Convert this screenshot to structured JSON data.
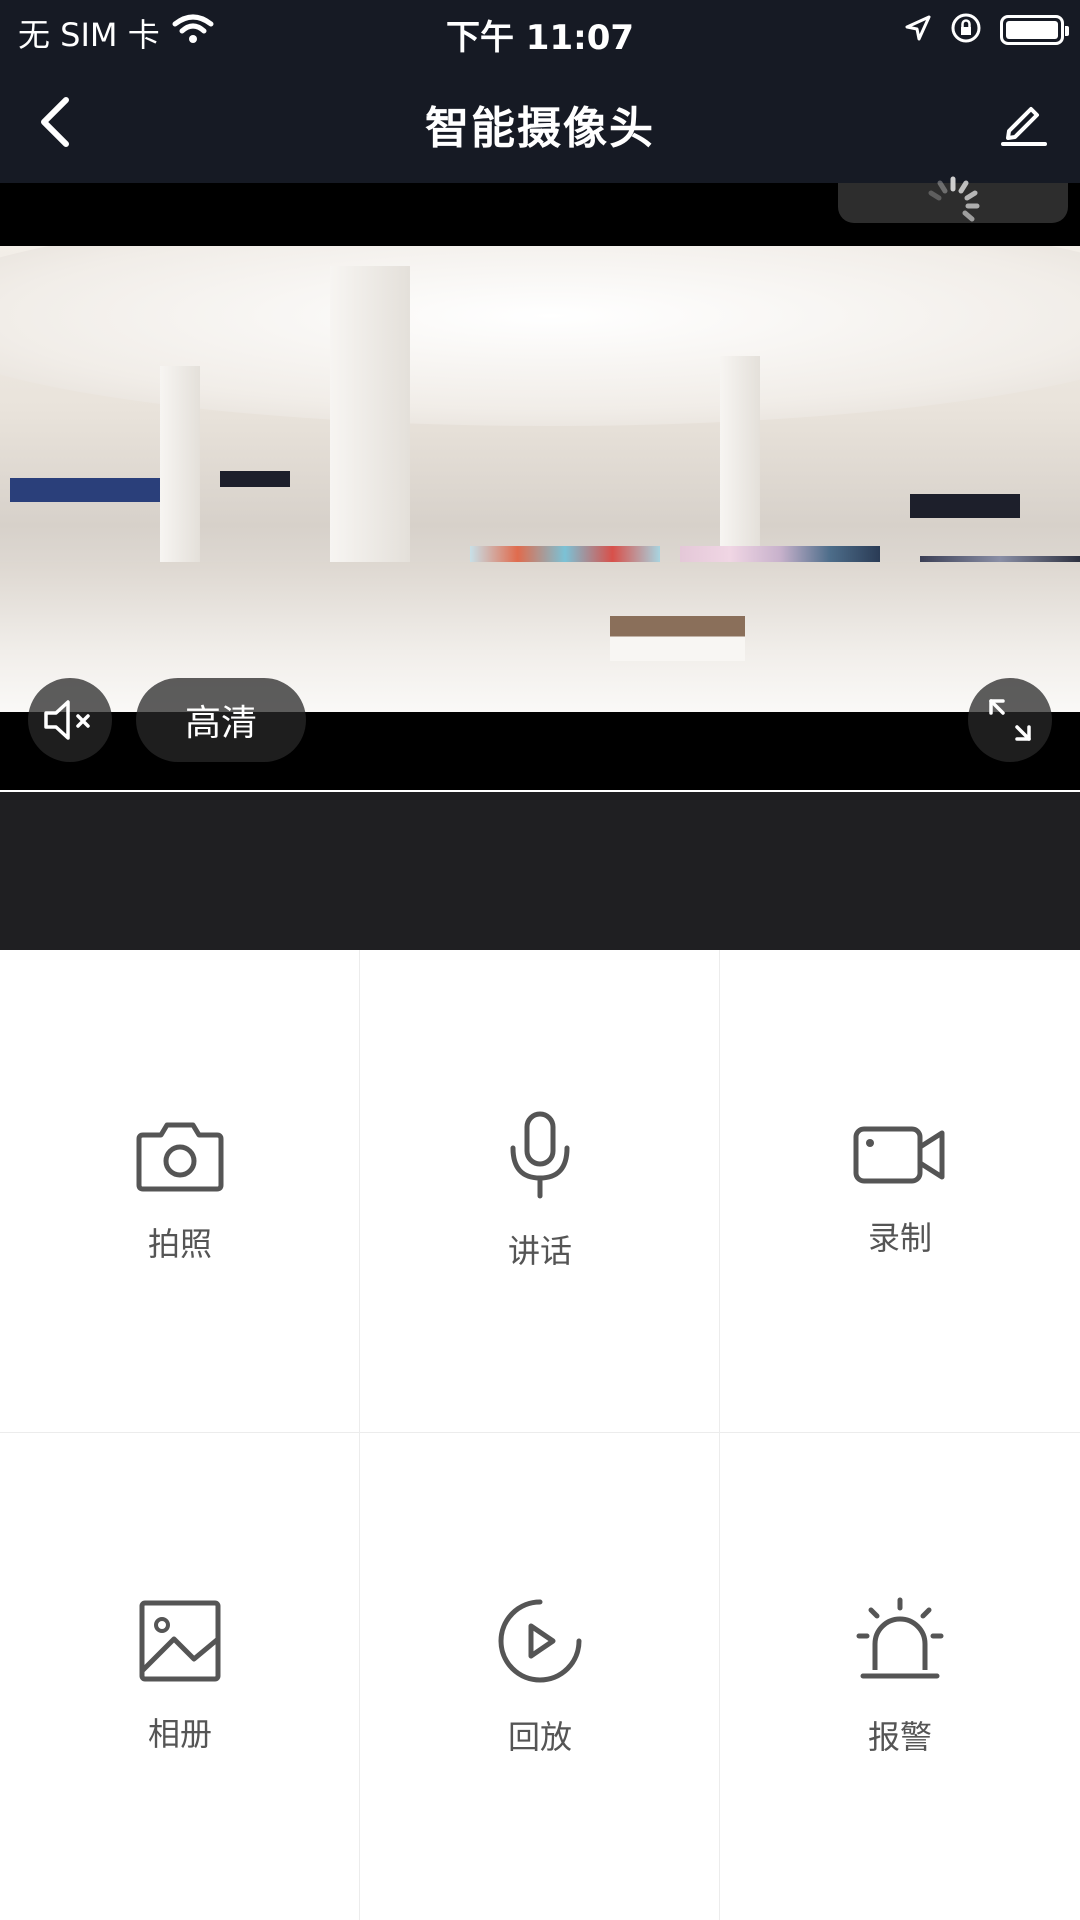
{
  "status_bar": {
    "carrier": "无 SIM 卡",
    "time": "下午 11:07"
  },
  "nav": {
    "title": "智能摄像头"
  },
  "video": {
    "quality_label": "高清"
  },
  "functions": [
    {
      "label": "拍照",
      "icon": "camera-icon"
    },
    {
      "label": "讲话",
      "icon": "microphone-icon"
    },
    {
      "label": "录制",
      "icon": "video-record-icon"
    },
    {
      "label": "相册",
      "icon": "image-icon"
    },
    {
      "label": "回放",
      "icon": "playback-icon"
    },
    {
      "label": "报警",
      "icon": "alarm-icon"
    }
  ],
  "colors": {
    "header_bg": "#161a24",
    "video_under_bg": "#1f1f22",
    "icon_color": "#555555"
  }
}
